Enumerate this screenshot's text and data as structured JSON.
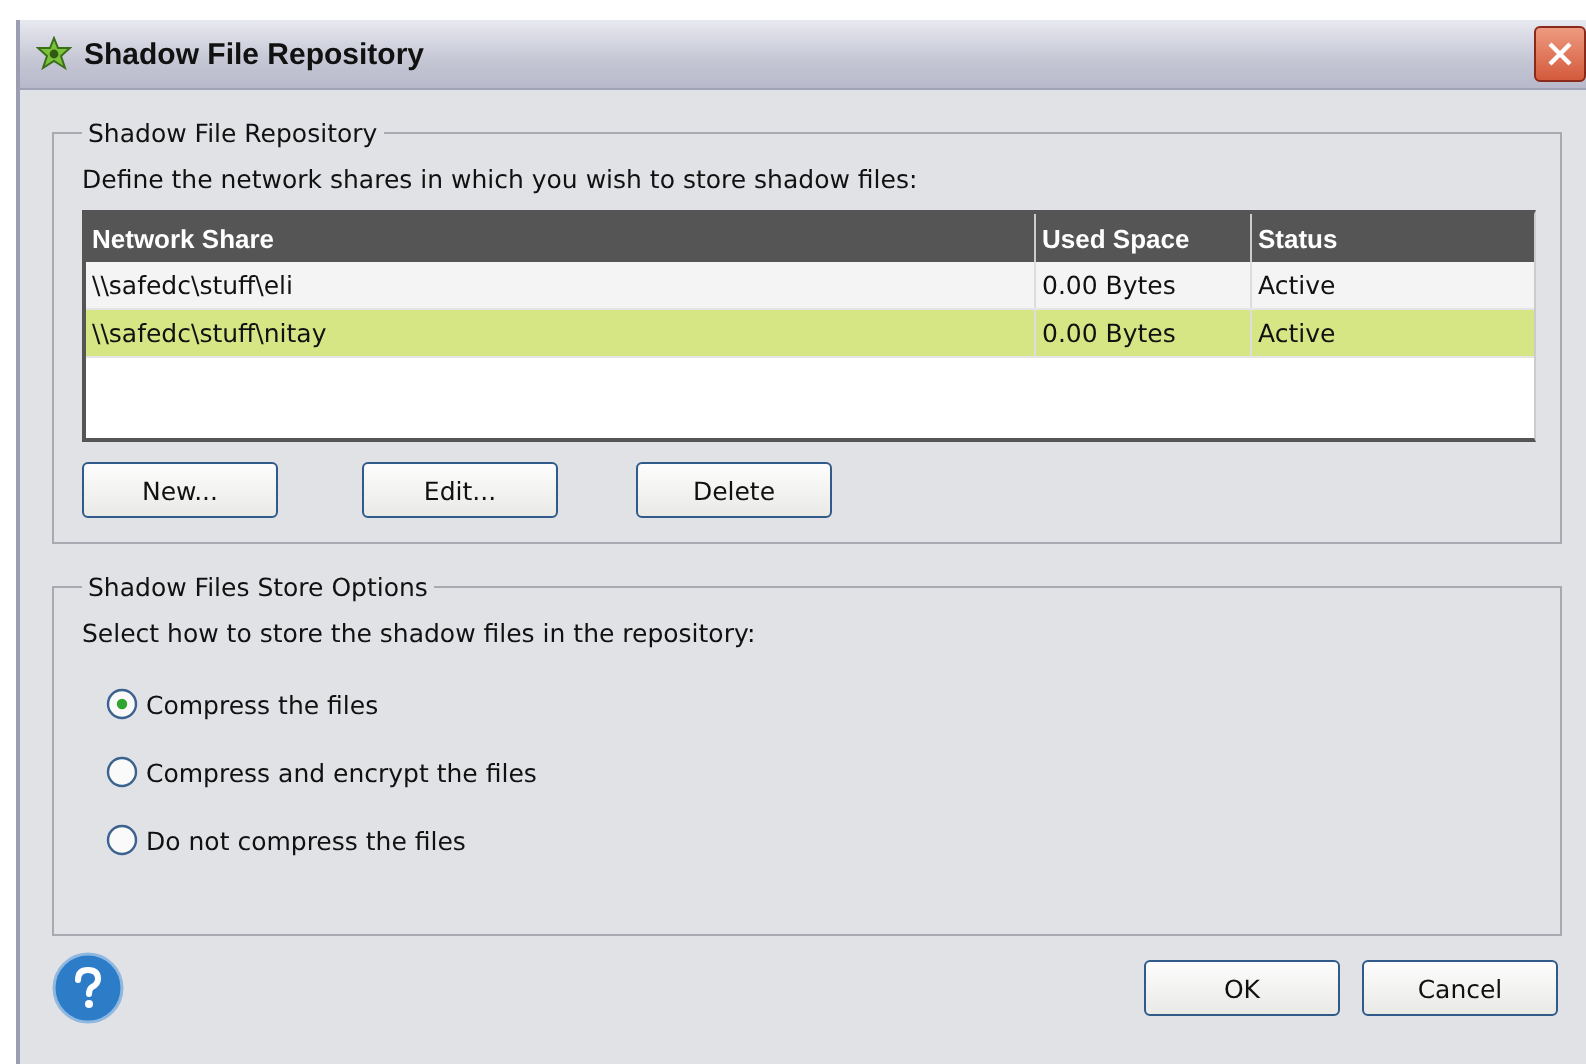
{
  "window": {
    "title": "Shadow File Repository"
  },
  "repository": {
    "legend": "Shadow File Repository",
    "description": "Define the network shares in which you wish to store shadow files:",
    "table": {
      "columns": [
        "Network Share",
        "Used Space",
        "Status"
      ],
      "rows": [
        {
          "cells": [
            "\\\\safedc\\stuff\\eli",
            "0.00 Bytes",
            "Active"
          ],
          "selected": false
        },
        {
          "cells": [
            "\\\\safedc\\stuff\\nitay",
            "0.00 Bytes",
            "Active"
          ],
          "selected": true
        }
      ]
    },
    "buttons": [
      "New...",
      "Edit...",
      "Delete"
    ]
  },
  "store_options": {
    "legend": "Shadow Files Store Options",
    "description": "Select how to store the shadow files in the repository:",
    "options": [
      {
        "label": "Compress the files",
        "selected": true
      },
      {
        "label": "Compress and encrypt the files",
        "selected": false
      },
      {
        "label": "Do not compress the files",
        "selected": false
      }
    ]
  },
  "footer": {
    "buttons": [
      "OK",
      "Cancel"
    ]
  }
}
